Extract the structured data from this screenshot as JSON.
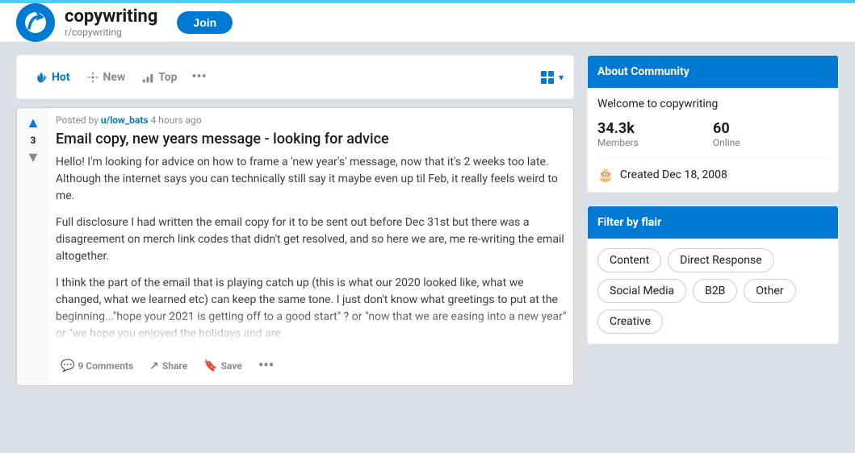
{
  "topbar": {
    "color": "#46d1fd"
  },
  "header": {
    "subreddit": "copywriting",
    "sub_label": "r/copywriting",
    "join_label": "Join"
  },
  "sort": {
    "items": [
      {
        "id": "hot",
        "label": "Hot",
        "active": true
      },
      {
        "id": "new",
        "label": "New",
        "active": false
      },
      {
        "id": "top",
        "label": "Top",
        "active": false
      }
    ],
    "more_label": "•••"
  },
  "post": {
    "author": "u/low_bats",
    "time": "4 hours ago",
    "vote_count": "3",
    "title": "Email copy, new years message - looking for advice",
    "body_paragraphs": [
      "Hello!\nI'm looking for advice on how to frame a 'new year's' message, now that it's 2 weeks too late. Although the internet says you can technically still say it maybe even up til Feb, it really feels weird to me.",
      "Full disclosure I had written the email copy for it to be sent out before Dec 31st but there was a disagreement on merch link codes that didn't get resolved, and so here we are, me re-writing the email altogether.",
      "I think the part of the email that is playing catch up (this is what our 2020 looked like, what we changed, what we learned etc) can keep the same tone. I just don't know what greetings to put at the beginning...\"hope your 2021 is getting off to a good start\" ? or \"now that we are easing into a new year\" or \"we hope you enjoyed the holidays and are"
    ],
    "actions": {
      "comments_label": "9 Comments",
      "share_label": "Share",
      "save_label": "Save"
    }
  },
  "sidebar": {
    "about": {
      "header": "About Community",
      "welcome": "Welcome to copywriting",
      "members_count": "34.3k",
      "members_label": "Members",
      "online_count": "60",
      "online_label": "Online",
      "created": "Created Dec 18, 2008"
    },
    "flair": {
      "header": "Filter by flair",
      "items": [
        "Content",
        "Direct Response",
        "Social Media",
        "B2B",
        "Other",
        "Creative"
      ]
    }
  }
}
